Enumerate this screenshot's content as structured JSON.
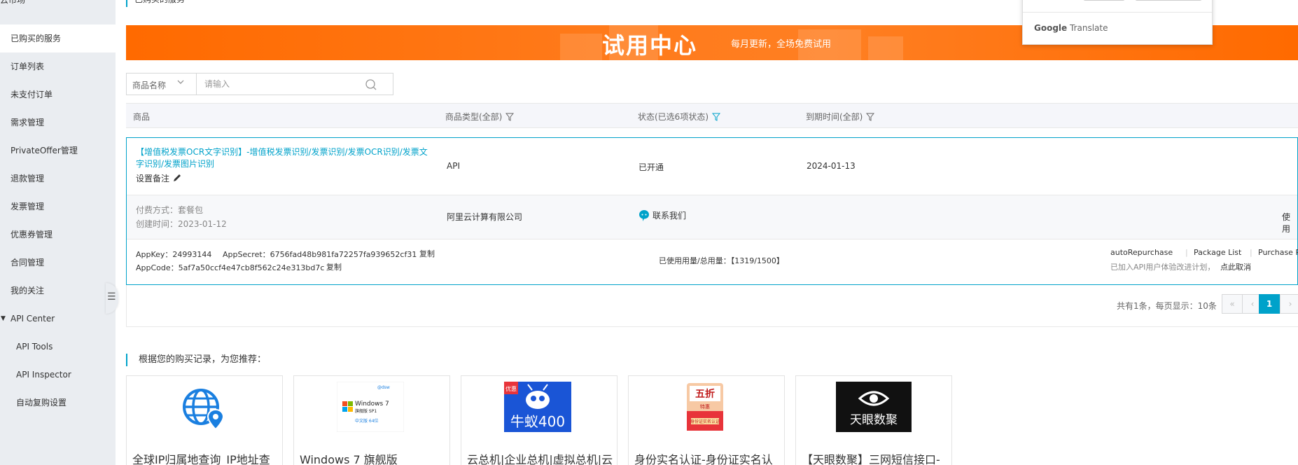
{
  "sidebar": {
    "title": "云市场",
    "items": [
      {
        "label": "已购买的服务",
        "active": true
      },
      {
        "label": "订单列表"
      },
      {
        "label": "未支付订单"
      },
      {
        "label": "需求管理"
      },
      {
        "label": "PrivateOffer管理"
      },
      {
        "label": "退款管理"
      },
      {
        "label": "发票管理"
      },
      {
        "label": "优惠券管理"
      },
      {
        "label": "合同管理"
      },
      {
        "label": "我的关注"
      },
      {
        "label": "API Center",
        "expanded": true
      },
      {
        "label": "API Tools"
      },
      {
        "label": "API Inspector"
      },
      {
        "label": "自动复购设置"
      }
    ]
  },
  "page": {
    "section_title": "已购买的服务"
  },
  "banner": {
    "title": "试用中心",
    "subtitle": "每月更新，全场免费试用"
  },
  "search": {
    "field_label": "商品名称",
    "placeholder": "请输入"
  },
  "table": {
    "headers": {
      "product": "商品",
      "type": "商品类型(全部)",
      "status": "状态(已选6项状态)",
      "expiry": "到期时间(全部)"
    }
  },
  "order": {
    "product_name": "【增值税发票OCR文字识别】-增值税发票识别/发票识别/发票OCR识别/发票文字识别/发票图片识别",
    "note_label": "设置备注",
    "type": "API",
    "status": "已开通",
    "expiry": "2024-01-13",
    "pay_method": "付费方式：套餐包",
    "created": "创建时间：2023-01-12",
    "vendor": "阿里云计算有限公司",
    "contact": "联系我们",
    "use_link": "使用",
    "appkey": "AppKey：24993144",
    "appsecret": "AppSecret：6756fad48b981fa72257fa939652cf31",
    "appcode": "AppCode：5af7a50ccf4e47cb8f562c24e313bd7c",
    "copy_label": "复制",
    "usage": "已使用用量/总用量：【1319/1500】",
    "auto_repurchase": "autoRepurchase",
    "package_list": "Package List",
    "purchase_pack": "Purchase Pack",
    "plan_text": "已加入API用户体验改进计划，",
    "plan_cancel": "点此取消"
  },
  "pagination": {
    "summary": "共有1条，每页显示：10条",
    "first": "«",
    "prev": "‹",
    "current": "1",
    "next": "›"
  },
  "recommend": {
    "title": "根据您的购买记录，为您推荐：",
    "cards": [
      {
        "title": "全球IP归属地查询_IP地址查",
        "icon": "globe-location-icon",
        "img_text": ""
      },
      {
        "title": "Windows 7 旗舰版",
        "icon": "windows-logo-icon",
        "img_text": "Windows 7",
        "img_text2": "旗舰版 SP1",
        "img_text3": "中文版  64位"
      },
      {
        "title": "云总机|企业总机|虚拟总机|云",
        "icon": "ant-logo-icon",
        "img_text": "牛蚁400",
        "img_badge": "优惠"
      },
      {
        "title": "身份实名认证-身份证实名认",
        "icon": "coupon-icon",
        "img_text": "五折",
        "img_text2": "特惠",
        "img_text3": "身份证实名认证"
      },
      {
        "title": "【天眼数聚】三网短信接口-",
        "icon": "eye-logo-icon",
        "img_text": "天眼数聚"
      }
    ]
  },
  "translate": {
    "brand_google": "Google",
    "brand_translate": "Translate"
  },
  "colors": {
    "accent": "#00a2ca",
    "banner": "#ff6a00",
    "sidebar_bg": "#eaedf1"
  }
}
